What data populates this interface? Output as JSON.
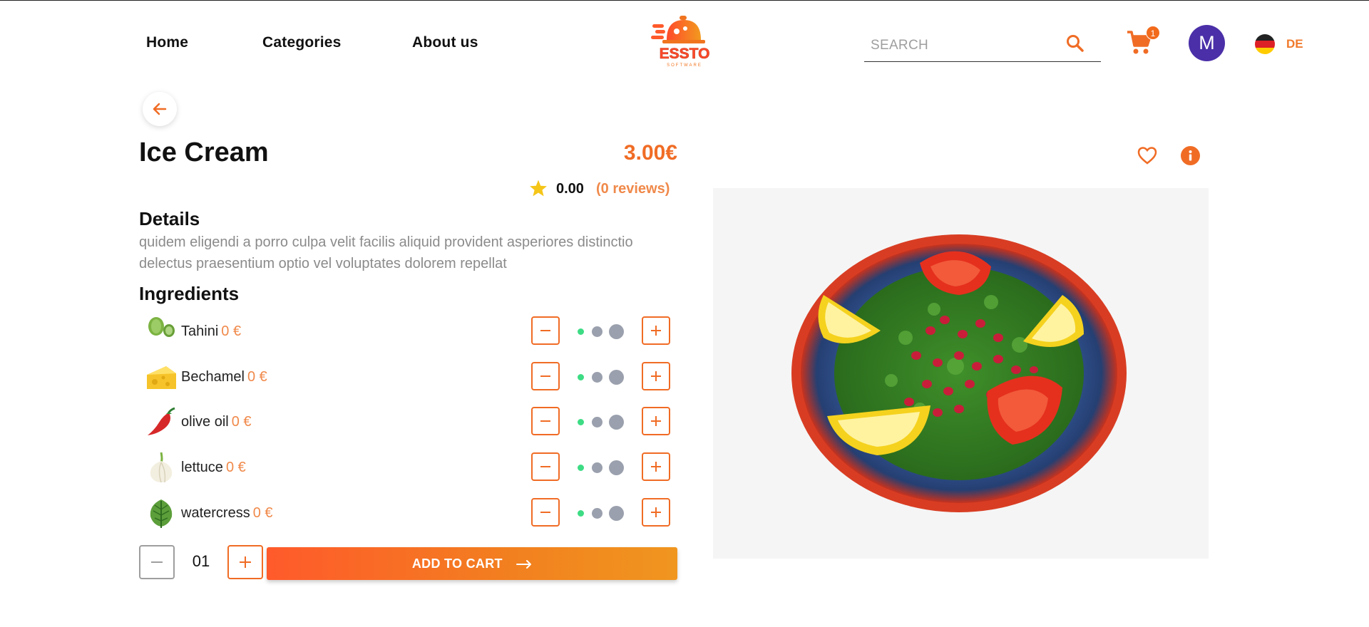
{
  "header": {
    "nav": [
      "Home",
      "Categories",
      "About us"
    ],
    "logo_text": "ESSTO",
    "logo_sub": "SOFTWARE",
    "search_placeholder": "SEARCH",
    "cart_count": "1",
    "avatar_initial": "M",
    "language": "DE"
  },
  "product": {
    "title": "Ice Cream",
    "price": "3.00€",
    "rating": "0.00",
    "reviews": "(0 reviews)",
    "details_heading": "Details",
    "description": "quidem eligendi a porro culpa velit facilis aliquid provident asperiores distinctio delectus praesentium optio vel voluptates dolorem repellat",
    "ingredients_heading": "Ingredients",
    "ingredients": [
      {
        "name": "Tahini",
        "price": "0 €",
        "icon": "green-olives-icon"
      },
      {
        "name": "Bechamel",
        "price": "0 €",
        "icon": "cheese-icon"
      },
      {
        "name": "olive oil",
        "price": "0 €",
        "icon": "chili-pepper-icon"
      },
      {
        "name": "lettuce",
        "price": "0 €",
        "icon": "garlic-icon"
      },
      {
        "name": "watercress",
        "price": "0 €",
        "icon": "leaf-icon"
      }
    ]
  },
  "cart_bar": {
    "quantity": "01",
    "add_to_cart_label": "ADD TO CART"
  },
  "colors": {
    "accent": "#f06c25",
    "avatar": "#4a2fa8",
    "dot_active": "#3ddc84",
    "dot_inactive": "#9aa0ad"
  }
}
